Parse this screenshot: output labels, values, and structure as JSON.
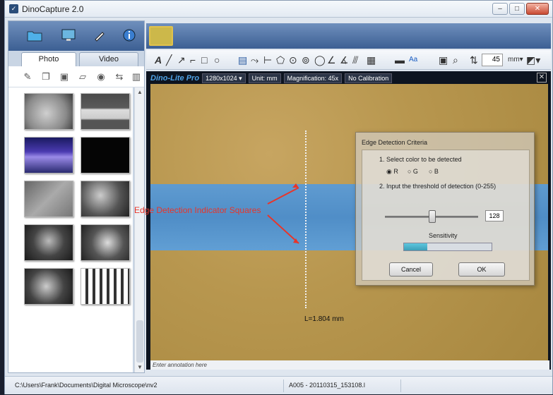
{
  "window": {
    "title": "DinoCapture 2.0",
    "minimize": "–",
    "maximize": "□",
    "close": "✕"
  },
  "left_toolbar": {
    "icons": [
      "folder-icon",
      "monitor-icon",
      "pen-icon",
      "info-icon"
    ]
  },
  "tabs": {
    "photo": "Photo",
    "video": "Video"
  },
  "file_toolbar_icons": [
    "brush-icon",
    "copy-icon",
    "save-icon",
    "tag-icon",
    "settings-icon",
    "shuffle-icon",
    "trash-icon"
  ],
  "viewer": {
    "brand": "Dino-Lite Pro",
    "resolution": "1280x1024 ▾",
    "unit": "Unit: mm",
    "magnification": "Magnification: 45x",
    "calibration": "No Calibration",
    "close": "✕"
  },
  "draw_toolbar": {
    "zoom_value": "45"
  },
  "annotations": {
    "edge_indicator": "Edge Detection Indicator Squares",
    "measurement": "L=1.804 mm"
  },
  "dialog": {
    "title": "Edge Detection Criteria",
    "step1": "1. Select color to be detected",
    "radio_r": "◉ R",
    "radio_g": "○ G",
    "radio_b": "○ B",
    "step2": "2. Input the threshold of detection (0-255)",
    "threshold": "128",
    "sensitivity_label": "Sensitivity",
    "sensitivity_level": 0.27,
    "cancel": "Cancel",
    "ok": "OK"
  },
  "annotation_input": {
    "placeholder": "Enter annotation here"
  },
  "statusbar": {
    "path": "C:\\Users\\Frank\\Documents\\Digital Microscope\\nv2",
    "file": "A005 - 20110315_153108.l"
  },
  "colors": {
    "accent_blue": "#3c5f93",
    "annotation_red": "#e8352a",
    "blue_band": "#4a8dcd"
  }
}
